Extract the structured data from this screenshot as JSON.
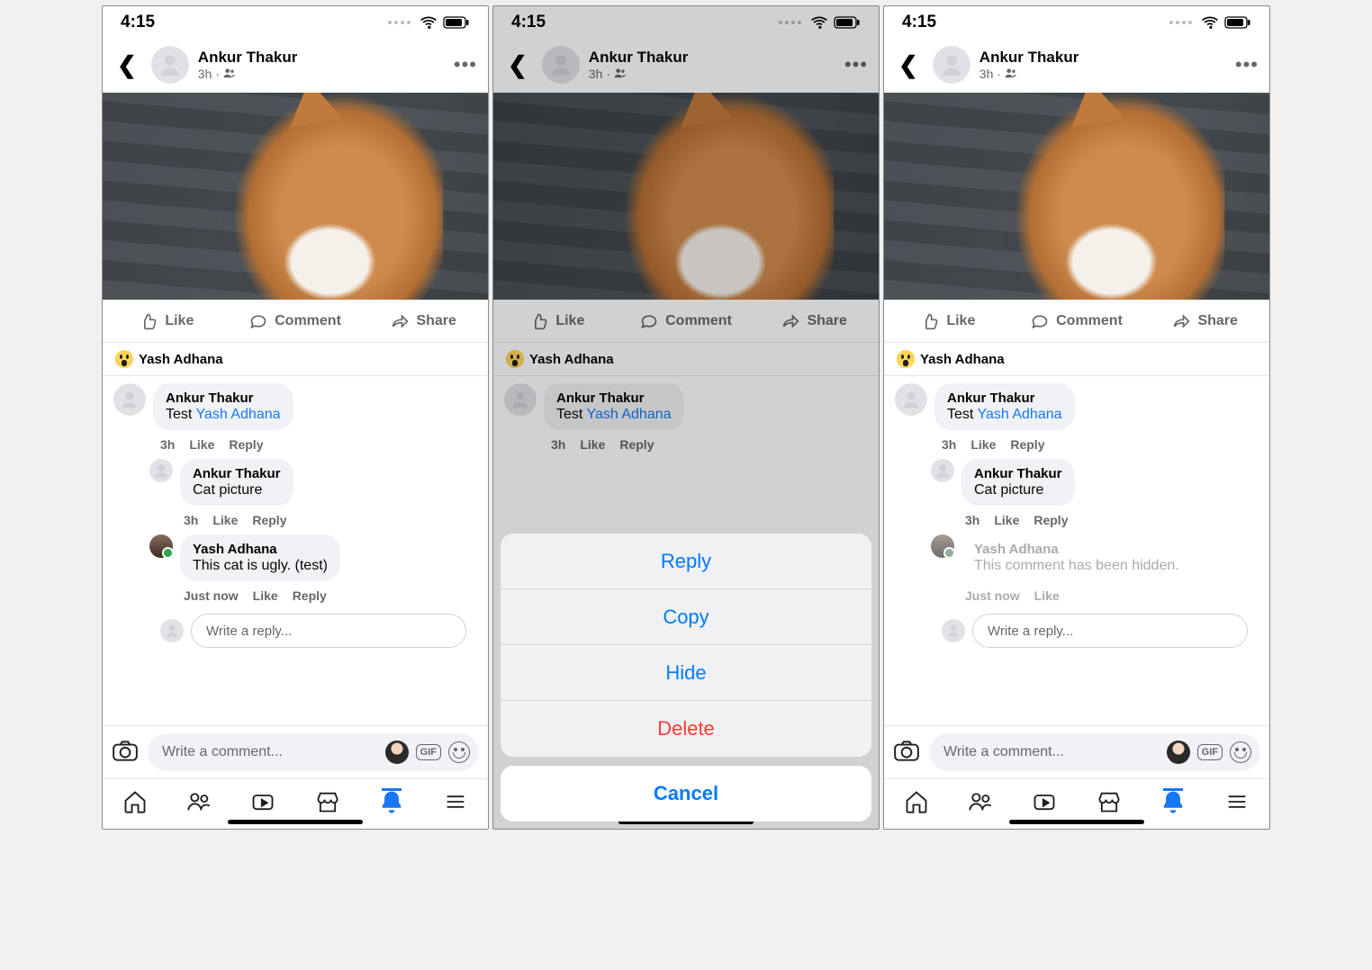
{
  "status_time": "4:15",
  "post": {
    "author": "Ankur Thakur",
    "time": "3h",
    "audience_icon": "friends-icon"
  },
  "actions": {
    "like": "Like",
    "comment": "Comment",
    "share": "Share"
  },
  "reaction_summary": {
    "reactor_name": "Yash Adhana"
  },
  "comments": {
    "c1": {
      "author": "Ankur Thakur",
      "text_prefix": "Test ",
      "tag": "Yash Adhana",
      "time": "3h"
    },
    "c2": {
      "author": "Ankur Thakur",
      "text": "Cat picture",
      "time": "3h"
    },
    "c3": {
      "author": "Yash Adhana",
      "text": "This cat is ugly. (test)",
      "time": "Just now"
    },
    "c3_hidden": {
      "author": "Yash Adhana",
      "text": "This comment has been hidden.",
      "time": "Just now"
    }
  },
  "labels": {
    "like_small": "Like",
    "reply_small": "Reply",
    "reply_placeholder": "Write a reply...",
    "comment_placeholder": "Write a comment...",
    "gif": "GIF"
  },
  "action_sheet": {
    "reply": "Reply",
    "copy": "Copy",
    "hide": "Hide",
    "delete": "Delete",
    "cancel": "Cancel"
  }
}
